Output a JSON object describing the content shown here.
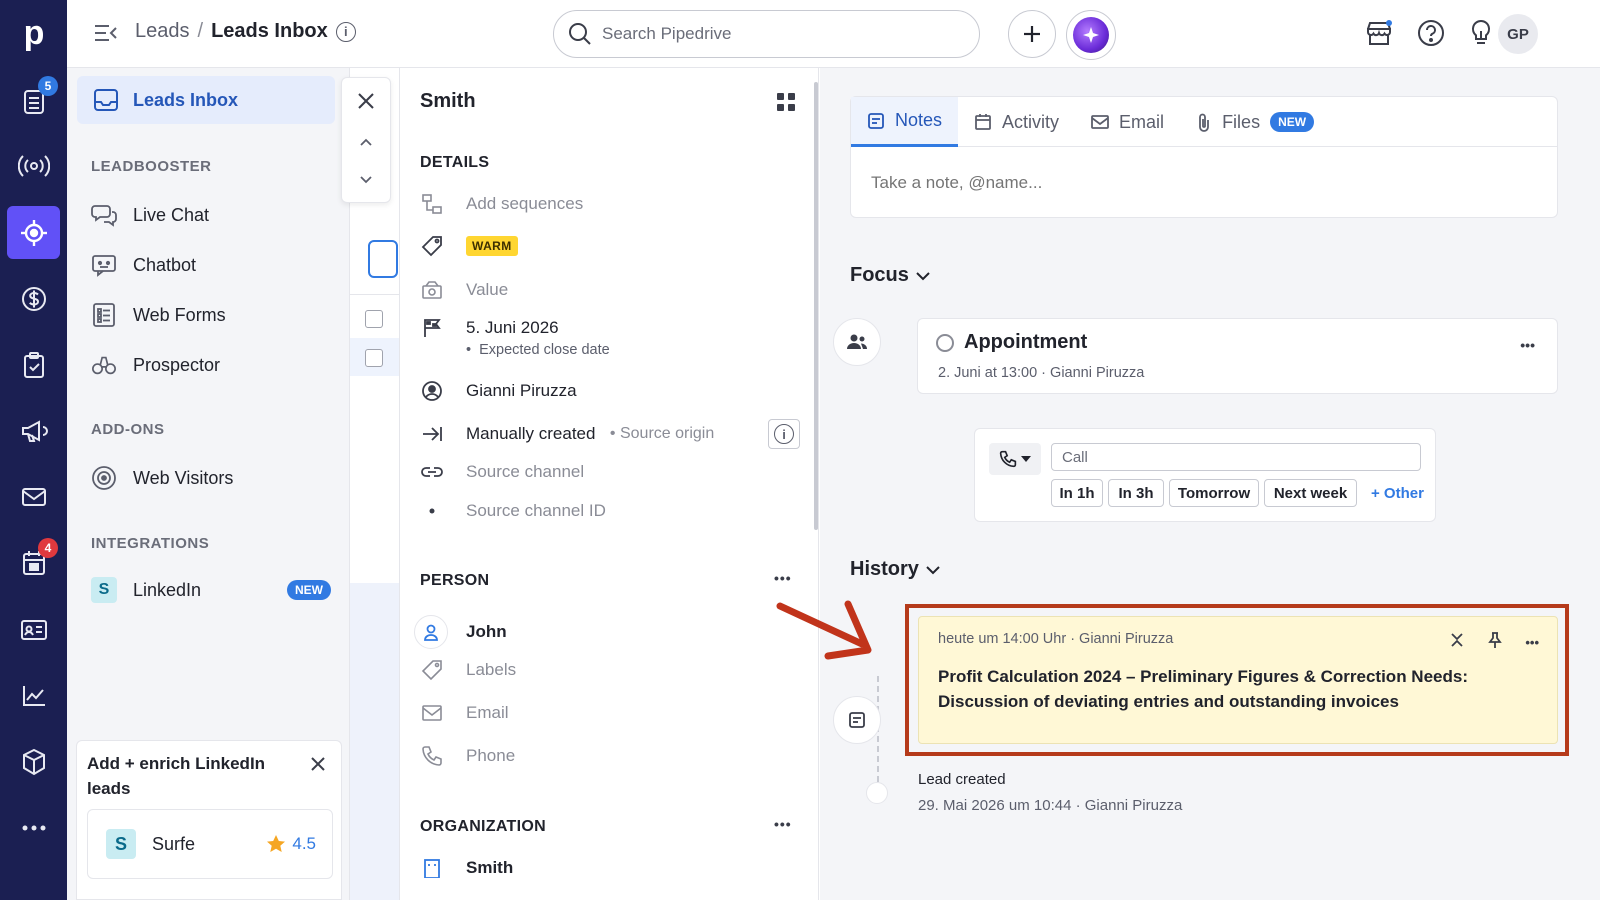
{
  "rail": {
    "logo": "p",
    "badges": {
      "leads": "5",
      "calendar": "4"
    },
    "items": [
      "leads-icon",
      "campaigns-radio-icon",
      "leadbooster-target-icon",
      "deals-dollar-icon",
      "activities-clipboard-icon",
      "campaigns-megaphone-icon",
      "mail-icon",
      "calendar-icon",
      "contacts-card-icon",
      "insights-chart-icon",
      "products-box-icon",
      "more-icon"
    ]
  },
  "header": {
    "breadcrumb_root": "Leads",
    "breadcrumb_sep": "/",
    "breadcrumb_current": "Leads Inbox",
    "search_placeholder": "Search Pipedrive",
    "avatar": "GP"
  },
  "sidebar": {
    "active": "Leads Inbox",
    "leadbooster_head": "LEADBOOSTER",
    "leadbooster": [
      "Live Chat",
      "Chatbot",
      "Web Forms",
      "Prospector"
    ],
    "addons_head": "ADD-ONS",
    "addons": [
      "Web Visitors"
    ],
    "integrations_head": "INTEGRATIONS",
    "integration": "LinkedIn",
    "integration_badge": "NEW",
    "promo_title": "Add + enrich LinkedIn leads",
    "promo_app": "Surfe",
    "promo_logo": "S",
    "promo_rating": "4.5"
  },
  "detail": {
    "title": "Smith",
    "details_head": "DETAILS",
    "add_sequences": "Add sequences",
    "label": "WARM",
    "value": "Value",
    "close_date": "5. Juni 2026",
    "close_date_caption": "Expected close date",
    "owner": "Gianni Piruzza",
    "source_origin_value": "Manually created",
    "source_origin_label": "Source origin",
    "source_channel": "Source channel",
    "source_channel_id": "Source channel ID",
    "person_head": "PERSON",
    "person_name": "John",
    "person_labels": "Labels",
    "person_email": "Email",
    "person_phone": "Phone",
    "org_head": "ORGANIZATION",
    "org_name": "Smith"
  },
  "right": {
    "tabs": [
      "Notes",
      "Activity",
      "Email",
      "Files"
    ],
    "files_badge": "NEW",
    "note_placeholder": "Take a note, @name...",
    "focus_head": "Focus",
    "appointment_title": "Appointment",
    "appointment_sub": "2. Juni at 13:00 · Gianni Piruzza",
    "call_placeholder": "Call",
    "quick": [
      "In 1h",
      "In 3h",
      "Tomorrow",
      "Next week"
    ],
    "quick_other": "+ Other",
    "history_head": "History",
    "note_meta": "heute um 14:00 Uhr · Gianni Piruzza",
    "note_text": "Profit Calculation 2024 – Preliminary Figures & Correction Needs: Discussion of deviating entries and outstanding invoices",
    "created_title": "Lead created",
    "created_sub": "29. Mai 2026 um 10:44 · Gianni Piruzza"
  },
  "colors": {
    "rail_bg": "#1b1f52",
    "rail_active": "#6151f7",
    "accent": "#317ae2",
    "warm_label": "#ffd631",
    "note_bg": "#fff8d6",
    "highlight": "#b53a1b"
  }
}
